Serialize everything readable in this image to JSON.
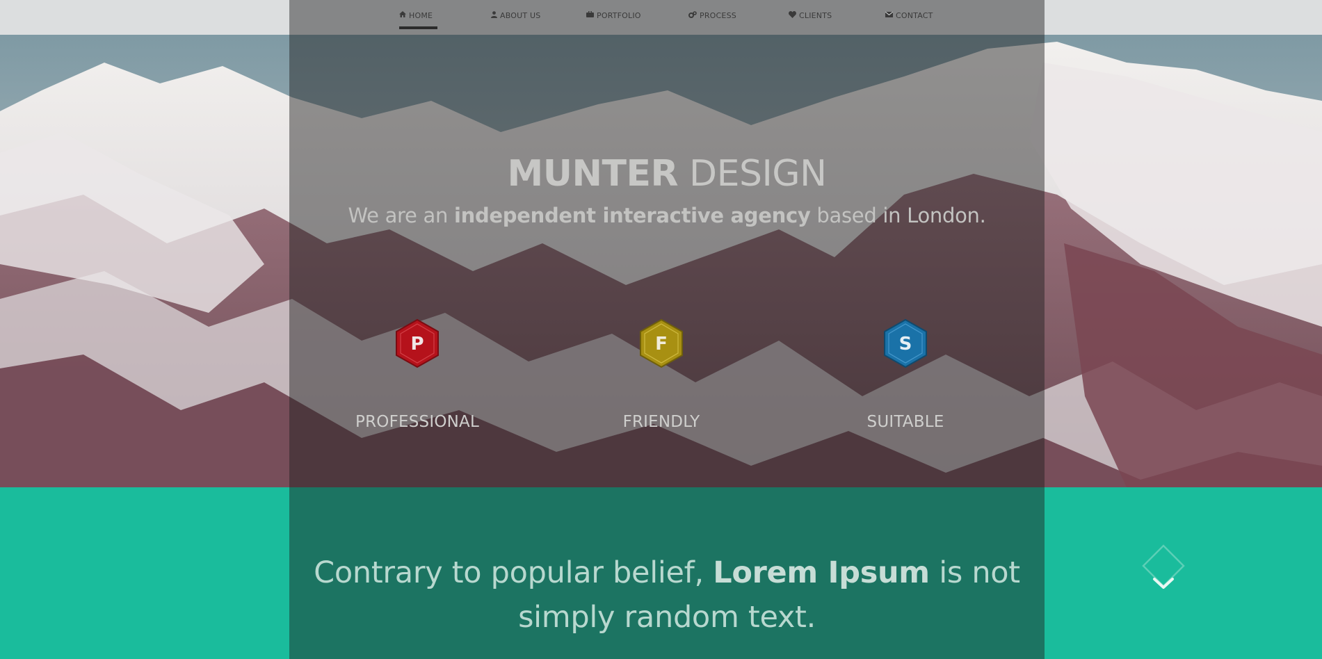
{
  "nav": {
    "items": [
      {
        "label": "HOME",
        "icon": "home-icon"
      },
      {
        "label": "ABOUT US",
        "icon": "user-icon"
      },
      {
        "label": "PORTFOLIO",
        "icon": "briefcase-icon"
      },
      {
        "label": "PROCESS",
        "icon": "gears-icon"
      },
      {
        "label": "CLIENTS",
        "icon": "heart-icon"
      },
      {
        "label": "CONTACT",
        "icon": "envelope-icon"
      }
    ],
    "active": "HOME"
  },
  "hero": {
    "brand_bold": "MUNTER",
    "brand_light": " DESIGN",
    "tagline_pre": "We are an ",
    "tagline_bold": "independent interactive agency",
    "tagline_post": " based in London."
  },
  "features": [
    {
      "letter": "P",
      "label": "PROFESSIONAL",
      "color": "#b5121b"
    },
    {
      "letter": "F",
      "label": "FRIENDLY",
      "color": "#b59a12"
    },
    {
      "letter": "S",
      "label": "SUITABLE",
      "color": "#1a7ab5"
    }
  ],
  "quote": {
    "pre": "Contrary to popular belief, ",
    "bold": "Lorem Ipsum",
    "post": " is not simply random text."
  },
  "scroll": {
    "icon": "chevron-down-icon"
  },
  "colors": {
    "teal": "#1abc9c",
    "topbar": "#dcdedf"
  }
}
